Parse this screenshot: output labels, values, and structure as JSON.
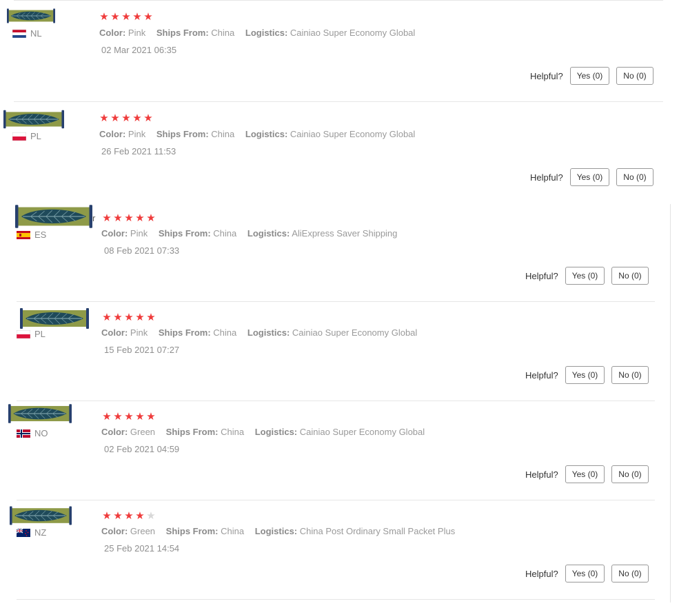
{
  "labels": {
    "color": "Color:",
    "ships_from": "Ships From:",
    "logistics": "Logistics:",
    "helpful": "Helpful?"
  },
  "colors": {
    "star_on": "#ef3b3b",
    "star_off": "#d8d8d8"
  },
  "reviews": [
    {
      "country": "NL",
      "color": "Pink",
      "ships_from": "China",
      "logistics": "Cainiao Super Economy Global",
      "date": "02 Mar 2021 06:35",
      "rating": 5,
      "yes": "Yes (0)",
      "no": "No (0)"
    },
    {
      "country": "PL",
      "color": "Pink",
      "ships_from": "China",
      "logistics": "Cainiao Super Economy Global",
      "date": "26 Feb 2021 11:53",
      "rating": 5,
      "yes": "Yes (0)",
      "no": "No (0)"
    },
    {
      "country": "ES",
      "color": "Pink",
      "ships_from": "China",
      "logistics": "AliExpress Saver Shipping",
      "date": "08 Feb 2021 07:33",
      "rating": 5,
      "yes": "Yes (0)",
      "no": "No (0)",
      "name_fragment": "r"
    },
    {
      "country": "PL",
      "color": "Pink",
      "ships_from": "China",
      "logistics": "Cainiao Super Economy Global",
      "date": "15 Feb 2021 07:27",
      "rating": 5,
      "yes": "Yes (0)",
      "no": "No (0)"
    },
    {
      "country": "NO",
      "color": "Green",
      "ships_from": "China",
      "logistics": "Cainiao Super Economy Global",
      "date": "02 Feb 2021 04:59",
      "rating": 5,
      "yes": "Yes (0)",
      "no": "No (0)"
    },
    {
      "country": "NZ",
      "color": "Green",
      "ships_from": "China",
      "logistics": "China Post Ordinary Small Packet Plus",
      "date": "25 Feb 2021 14:54",
      "rating": 4,
      "yes": "Yes (0)",
      "no": "No (0)"
    }
  ]
}
